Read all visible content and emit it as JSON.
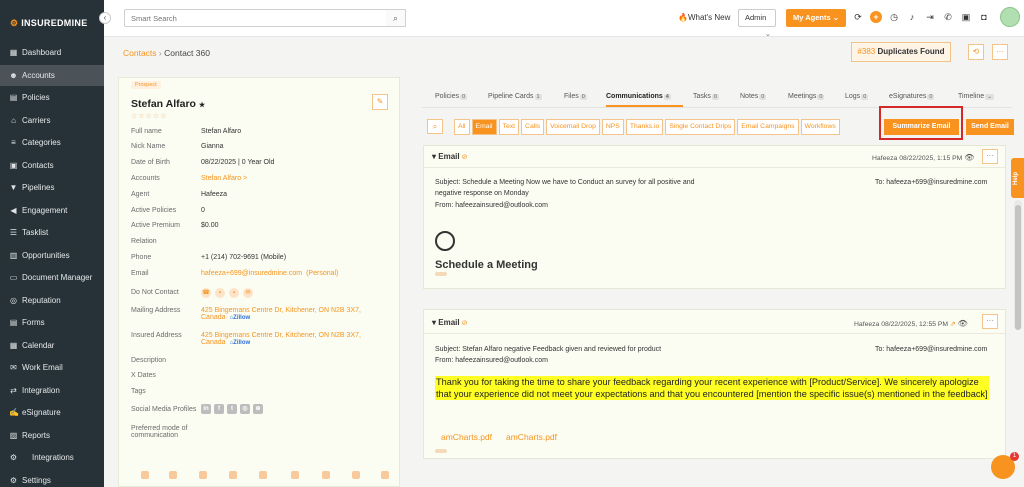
{
  "app": {
    "brand": "INSUREDMINE"
  },
  "sidebar": {
    "items": [
      {
        "label": "Dashboard",
        "icon": "dashboard-icon"
      },
      {
        "label": "Accounts",
        "icon": "user-icon",
        "active": true
      },
      {
        "label": "Policies",
        "icon": "policy-icon"
      },
      {
        "label": "Carriers",
        "icon": "bank-icon"
      },
      {
        "label": "Categories",
        "icon": "layers-icon"
      },
      {
        "label": "Contacts",
        "icon": "contacts-icon"
      },
      {
        "label": "Pipelines",
        "icon": "funnel-icon"
      },
      {
        "label": "Engagement",
        "icon": "megaphone-icon"
      },
      {
        "label": "Tasklist",
        "icon": "task-icon"
      },
      {
        "label": "Opportunities",
        "icon": "chart-icon"
      },
      {
        "label": "Document Manager",
        "icon": "folder-icon"
      },
      {
        "label": "Reputation",
        "icon": "reputation-icon"
      },
      {
        "label": "Forms",
        "icon": "forms-icon"
      },
      {
        "label": "Calendar",
        "icon": "calendar-icon"
      },
      {
        "label": "Work Email",
        "icon": "mail-icon"
      },
      {
        "label": "Integration",
        "icon": "integration-icon"
      },
      {
        "label": "eSignature",
        "icon": "signature-icon"
      },
      {
        "label": "Reports",
        "icon": "reports-icon"
      },
      {
        "label": "Integrations",
        "icon": "integrations-icon"
      },
      {
        "label": "Settings",
        "icon": "gear-icon"
      }
    ]
  },
  "topbar": {
    "search_placeholder": "Smart Search",
    "whats_new": "What's New",
    "admin": "Admin",
    "my_agents": "My Agents"
  },
  "breadcrumb": {
    "parent": "Contacts",
    "current": "Contact 360"
  },
  "duplicates": {
    "id": "#383",
    "label": "Duplicates Found"
  },
  "contact": {
    "status": "Prospect",
    "name": "Stefan Alfaro",
    "rating": "☆☆☆☆☆",
    "fields": [
      {
        "label": "Full name",
        "value": "Stefan Alfaro"
      },
      {
        "label": "Nick Name",
        "value": "Gianna"
      },
      {
        "label": "Date of Birth",
        "value": "08/22/2025 | 0 Year Old"
      },
      {
        "label": "Accounts",
        "value": "Stefan Alfaro >"
      },
      {
        "label": "Agent",
        "value": "Hafeeza"
      },
      {
        "label": "Active Policies",
        "value": "0"
      },
      {
        "label": "Active Premium",
        "value": "$0.00"
      },
      {
        "label": "Relation",
        "value": ""
      },
      {
        "label": "Phone",
        "value": "+1 (214) 702-9691 (Mobile)"
      },
      {
        "label": "Email",
        "value": "hafeeza+699@insuredmine.com",
        "suffix": "(Personal)"
      },
      {
        "label": "Do Not Contact",
        "value": ""
      },
      {
        "label": "Mailing Address",
        "value": "425 Bingemans Centre Dr, Kitchener, ON N2B 3X7,",
        "value2": "Canada",
        "zillow": "Zillow"
      },
      {
        "label": "Insured Address",
        "value": "425 Bingemans Centre Dr, Kitchener, ON N2B 3X7,",
        "value2": "Canada",
        "zillow": "Zillow"
      },
      {
        "label": "Description",
        "value": ""
      },
      {
        "label": "X Dates",
        "value": ""
      },
      {
        "label": "Tags",
        "value": ""
      },
      {
        "label": "Social Media Profiles",
        "value": ""
      },
      {
        "label": "Preferred mode of",
        "label2": "communication",
        "value": ""
      }
    ]
  },
  "tabs": [
    {
      "label": "Policies",
      "count": "0"
    },
    {
      "label": "Pipeline Cards",
      "count": "1"
    },
    {
      "label": "Files",
      "count": "0"
    },
    {
      "label": "Communications",
      "count": "4",
      "active": true
    },
    {
      "label": "Tasks",
      "count": "0"
    },
    {
      "label": "Notes",
      "count": "0"
    },
    {
      "label": "Meetings",
      "count": "0"
    },
    {
      "label": "Logs",
      "count": "0"
    },
    {
      "label": "eSignatures",
      "count": "0"
    },
    {
      "label": "Timeline",
      "count": ""
    }
  ],
  "filters": [
    "All",
    "Email",
    "Text",
    "Calls",
    "Voicemail Drop",
    "NPS",
    "Thanks.io",
    "Single Contact Drips",
    "Email Campaigns",
    "Workflows"
  ],
  "actions": {
    "summarize": "Summarize Email",
    "send": "Send Email"
  },
  "emails": [
    {
      "type": "Email",
      "meta": "Hafeeza 08/22/2025, 1:15 PM",
      "subject": "Subject: Schedule a Meeting Now we have to Conduct an survey for all positive and",
      "subject2": "negative response on Monday",
      "to": "To: hafeeza+699@insuredmine.com",
      "from": "From: hafeezainsured@outlook.com",
      "body_title": "Schedule a Meeting"
    },
    {
      "type": "Email",
      "meta": "Hafeeza 08/22/2025, 12:55 PM",
      "subject": "Subject: Stefan Alfaro negative Feedback given and reviewed for product",
      "to": "To: hafeeza+699@insuredmine.com",
      "from": "From: hafeezainsured@outlook.com",
      "body": "Thank you for taking the time to share your feedback regarding your recent experience with [Product/Service].  We sincerely apologize that your experience did not meet your expectations and that you encountered [mention the specific issue(s) mentioned in the feedback]",
      "attachments": [
        "amCharts.pdf",
        "amCharts.pdf"
      ]
    }
  ],
  "help": {
    "label": "Help"
  },
  "chat": {
    "badge": "1"
  }
}
